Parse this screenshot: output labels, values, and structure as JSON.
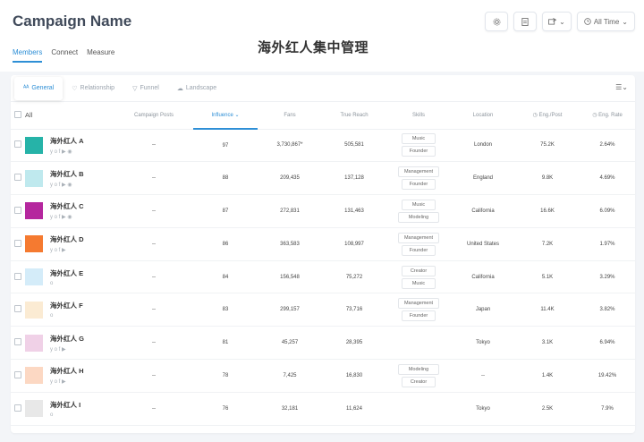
{
  "header": {
    "title": "Campaign Name",
    "center_title": "海外红人集中管理",
    "date_filter": "All Time"
  },
  "nav": {
    "tabs": [
      "Members",
      "Connect",
      "Measure"
    ]
  },
  "subtabs": [
    "General",
    "Relationship",
    "Funnel",
    "Landscape"
  ],
  "table": {
    "select_all_label": "All",
    "columns": [
      "Campaign Posts",
      "Influence",
      "Fans",
      "True Reach",
      "Skills",
      "Location",
      "Eng./Post",
      "Eng. Rate"
    ],
    "rows": [
      {
        "name": "海外红人 A",
        "color": "#26b3a8",
        "socials": "y o f ▶ ◉",
        "posts": "--",
        "influence": "97",
        "fans": "3,730,867*",
        "reach": "505,581",
        "skills": [
          "Music",
          "Founder"
        ],
        "location": "London",
        "eng_post": "75.2K",
        "eng_rate": "2.64%"
      },
      {
        "name": "海外红人 B",
        "color": "#bfe9ee",
        "socials": "y o f ▶ ◉",
        "posts": "--",
        "influence": "88",
        "fans": "209,435",
        "reach": "137,128",
        "skills": [
          "Management",
          "Founder"
        ],
        "location": "England",
        "eng_post": "9.8K",
        "eng_rate": "4.69%"
      },
      {
        "name": "海外红人 C",
        "color": "#b5279e",
        "socials": "y o f ▶ ◉",
        "posts": "--",
        "influence": "87",
        "fans": "272,831",
        "reach": "131,463",
        "skills": [
          "Music",
          "Modeling"
        ],
        "location": "California",
        "eng_post": "16.6K",
        "eng_rate": "6.09%"
      },
      {
        "name": "海外红人 D",
        "color": "#f57a30",
        "socials": "y o f ▶",
        "posts": "--",
        "influence": "86",
        "fans": "363,583",
        "reach": "108,997",
        "skills": [
          "Management",
          "Founder"
        ],
        "location": "United States",
        "eng_post": "7.2K",
        "eng_rate": "1.97%"
      },
      {
        "name": "海外红人 E",
        "color": "#d4ecf9",
        "socials": "o",
        "posts": "--",
        "influence": "84",
        "fans": "156,548",
        "reach": "75,272",
        "skills": [
          "Creator",
          "Music"
        ],
        "location": "California",
        "eng_post": "5.1K",
        "eng_rate": "3.29%"
      },
      {
        "name": "海外红人 F",
        "color": "#fbebd3",
        "socials": "o",
        "posts": "--",
        "influence": "83",
        "fans": "299,157",
        "reach": "73,716",
        "skills": [
          "Management",
          "Founder"
        ],
        "location": "Japan",
        "eng_post": "11.4K",
        "eng_rate": "3.82%"
      },
      {
        "name": "海外红人 G",
        "color": "#f0d1e7",
        "socials": "y o f ▶",
        "posts": "--",
        "influence": "81",
        "fans": "45,257",
        "reach": "28,395",
        "skills": [],
        "location": "Tokyo",
        "eng_post": "3.1K",
        "eng_rate": "6.94%"
      },
      {
        "name": "海外红人 H",
        "color": "#fcd8c3",
        "socials": "y o f ▶",
        "posts": "--",
        "influence": "78",
        "fans": "7,425",
        "reach": "16,830",
        "skills": [
          "Modeling",
          "Creator"
        ],
        "location": "--",
        "eng_post": "1.4K",
        "eng_rate": "19.42%"
      },
      {
        "name": "海外红人 I",
        "color": "#e8e8e8",
        "socials": "o",
        "posts": "--",
        "influence": "76",
        "fans": "32,181",
        "reach": "11,624",
        "skills": [],
        "location": "Tokyo",
        "eng_post": "2.5K",
        "eng_rate": "7.9%"
      }
    ]
  },
  "colors": {
    "accent": "#2e8fd6"
  }
}
